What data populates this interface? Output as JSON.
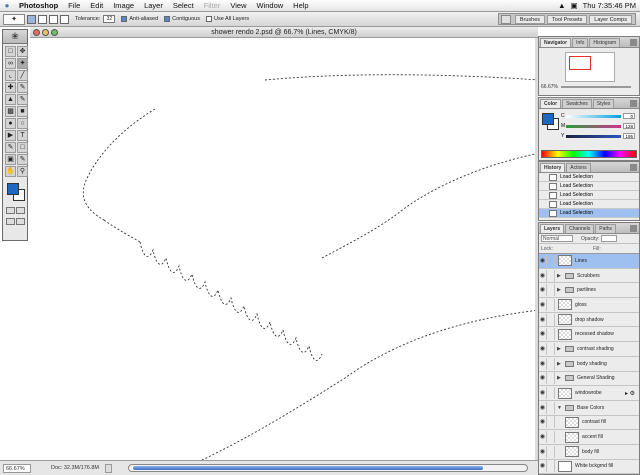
{
  "menubar": {
    "app_name": "Photoshop",
    "items": [
      "File",
      "Edit",
      "Image",
      "Layer",
      "Select",
      "Filter",
      "View",
      "Window",
      "Help"
    ],
    "clock": "Thu 7:35:46 PM"
  },
  "options_bar": {
    "tolerance_label": "Tolerance:",
    "tolerance_value": "32",
    "anti_aliased_label": "Anti-aliased",
    "contiguous_label": "Contiguous",
    "use_all_layers_label": "Use All Layers",
    "well_tabs": [
      "Brushes",
      "Tool Presets",
      "Layer Comps"
    ]
  },
  "document": {
    "title": "shower rendo 2.psd @ 66.7% (Lines, CMYK/8)",
    "zoom": "66.67%",
    "doc_size": "Doc: 32.3M/176.8M"
  },
  "navigator_palette": {
    "tabs": [
      "Navigator",
      "Info",
      "Histogram"
    ],
    "zoom": "66.67%"
  },
  "color_palette": {
    "tabs": [
      "Color",
      "Swatches",
      "Styles"
    ],
    "channels": [
      {
        "label": "C",
        "value": "0"
      },
      {
        "label": "M",
        "value": "128"
      },
      {
        "label": "Y",
        "value": "195"
      }
    ],
    "fg_color": "#1e68c1"
  },
  "history_palette": {
    "tabs": [
      "History",
      "Actions"
    ],
    "states": [
      "Load Selection",
      "Load Selection",
      "Load Selection",
      "Load Selection",
      "Load Selection"
    ],
    "selected_index": 4
  },
  "layers_palette": {
    "tabs": [
      "Layers",
      "Channels",
      "Paths"
    ],
    "blend_mode": "Normal",
    "opacity_label": "Opacity:",
    "lock_label": "Lock:",
    "fill_label": "Fill:",
    "layers": [
      {
        "name": "Lines",
        "kind": "layer",
        "selected": true,
        "indent": 0
      },
      {
        "name": "Scrubbers",
        "kind": "group",
        "selected": false,
        "indent": 0
      },
      {
        "name": "partlines",
        "kind": "group",
        "selected": false,
        "indent": 0
      },
      {
        "name": "gloss",
        "kind": "layer",
        "selected": false,
        "indent": 0
      },
      {
        "name": "drop shadow",
        "kind": "layer",
        "selected": false,
        "indent": 0
      },
      {
        "name": "recessed shadow",
        "kind": "layer",
        "selected": false,
        "indent": 0
      },
      {
        "name": "contrast shading",
        "kind": "group",
        "selected": false,
        "indent": 0
      },
      {
        "name": "body shading",
        "kind": "group",
        "selected": false,
        "indent": 0
      },
      {
        "name": "General Shading",
        "kind": "group",
        "selected": false,
        "indent": 0
      },
      {
        "name": "windowrobe",
        "kind": "layer",
        "selected": false,
        "indent": 0,
        "fx": true
      },
      {
        "name": "Base Colors",
        "kind": "group-open",
        "selected": false,
        "indent": 0
      },
      {
        "name": "contrast fill",
        "kind": "layer",
        "selected": false,
        "indent": 1
      },
      {
        "name": "accent fill",
        "kind": "layer",
        "selected": false,
        "indent": 1
      },
      {
        "name": "body fill",
        "kind": "layer",
        "selected": false,
        "indent": 1
      },
      {
        "name": "White bckgrnd fill",
        "kind": "layer-white",
        "selected": false,
        "indent": 0
      }
    ]
  }
}
